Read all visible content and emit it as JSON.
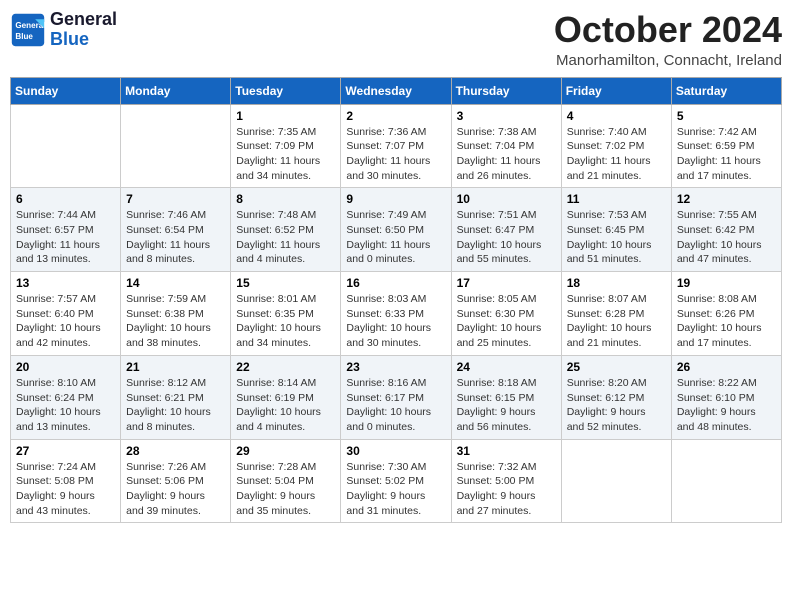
{
  "header": {
    "logo_line1": "General",
    "logo_line2": "Blue",
    "month": "October 2024",
    "location": "Manorhamilton, Connacht, Ireland"
  },
  "days_of_week": [
    "Sunday",
    "Monday",
    "Tuesday",
    "Wednesday",
    "Thursday",
    "Friday",
    "Saturday"
  ],
  "weeks": [
    [
      {
        "day": "",
        "detail": ""
      },
      {
        "day": "",
        "detail": ""
      },
      {
        "day": "1",
        "detail": "Sunrise: 7:35 AM\nSunset: 7:09 PM\nDaylight: 11 hours\nand 34 minutes."
      },
      {
        "day": "2",
        "detail": "Sunrise: 7:36 AM\nSunset: 7:07 PM\nDaylight: 11 hours\nand 30 minutes."
      },
      {
        "day": "3",
        "detail": "Sunrise: 7:38 AM\nSunset: 7:04 PM\nDaylight: 11 hours\nand 26 minutes."
      },
      {
        "day": "4",
        "detail": "Sunrise: 7:40 AM\nSunset: 7:02 PM\nDaylight: 11 hours\nand 21 minutes."
      },
      {
        "day": "5",
        "detail": "Sunrise: 7:42 AM\nSunset: 6:59 PM\nDaylight: 11 hours\nand 17 minutes."
      }
    ],
    [
      {
        "day": "6",
        "detail": "Sunrise: 7:44 AM\nSunset: 6:57 PM\nDaylight: 11 hours\nand 13 minutes."
      },
      {
        "day": "7",
        "detail": "Sunrise: 7:46 AM\nSunset: 6:54 PM\nDaylight: 11 hours\nand 8 minutes."
      },
      {
        "day": "8",
        "detail": "Sunrise: 7:48 AM\nSunset: 6:52 PM\nDaylight: 11 hours\nand 4 minutes."
      },
      {
        "day": "9",
        "detail": "Sunrise: 7:49 AM\nSunset: 6:50 PM\nDaylight: 11 hours\nand 0 minutes."
      },
      {
        "day": "10",
        "detail": "Sunrise: 7:51 AM\nSunset: 6:47 PM\nDaylight: 10 hours\nand 55 minutes."
      },
      {
        "day": "11",
        "detail": "Sunrise: 7:53 AM\nSunset: 6:45 PM\nDaylight: 10 hours\nand 51 minutes."
      },
      {
        "day": "12",
        "detail": "Sunrise: 7:55 AM\nSunset: 6:42 PM\nDaylight: 10 hours\nand 47 minutes."
      }
    ],
    [
      {
        "day": "13",
        "detail": "Sunrise: 7:57 AM\nSunset: 6:40 PM\nDaylight: 10 hours\nand 42 minutes."
      },
      {
        "day": "14",
        "detail": "Sunrise: 7:59 AM\nSunset: 6:38 PM\nDaylight: 10 hours\nand 38 minutes."
      },
      {
        "day": "15",
        "detail": "Sunrise: 8:01 AM\nSunset: 6:35 PM\nDaylight: 10 hours\nand 34 minutes."
      },
      {
        "day": "16",
        "detail": "Sunrise: 8:03 AM\nSunset: 6:33 PM\nDaylight: 10 hours\nand 30 minutes."
      },
      {
        "day": "17",
        "detail": "Sunrise: 8:05 AM\nSunset: 6:30 PM\nDaylight: 10 hours\nand 25 minutes."
      },
      {
        "day": "18",
        "detail": "Sunrise: 8:07 AM\nSunset: 6:28 PM\nDaylight: 10 hours\nand 21 minutes."
      },
      {
        "day": "19",
        "detail": "Sunrise: 8:08 AM\nSunset: 6:26 PM\nDaylight: 10 hours\nand 17 minutes."
      }
    ],
    [
      {
        "day": "20",
        "detail": "Sunrise: 8:10 AM\nSunset: 6:24 PM\nDaylight: 10 hours\nand 13 minutes."
      },
      {
        "day": "21",
        "detail": "Sunrise: 8:12 AM\nSunset: 6:21 PM\nDaylight: 10 hours\nand 8 minutes."
      },
      {
        "day": "22",
        "detail": "Sunrise: 8:14 AM\nSunset: 6:19 PM\nDaylight: 10 hours\nand 4 minutes."
      },
      {
        "day": "23",
        "detail": "Sunrise: 8:16 AM\nSunset: 6:17 PM\nDaylight: 10 hours\nand 0 minutes."
      },
      {
        "day": "24",
        "detail": "Sunrise: 8:18 AM\nSunset: 6:15 PM\nDaylight: 9 hours\nand 56 minutes."
      },
      {
        "day": "25",
        "detail": "Sunrise: 8:20 AM\nSunset: 6:12 PM\nDaylight: 9 hours\nand 52 minutes."
      },
      {
        "day": "26",
        "detail": "Sunrise: 8:22 AM\nSunset: 6:10 PM\nDaylight: 9 hours\nand 48 minutes."
      }
    ],
    [
      {
        "day": "27",
        "detail": "Sunrise: 7:24 AM\nSunset: 5:08 PM\nDaylight: 9 hours\nand 43 minutes."
      },
      {
        "day": "28",
        "detail": "Sunrise: 7:26 AM\nSunset: 5:06 PM\nDaylight: 9 hours\nand 39 minutes."
      },
      {
        "day": "29",
        "detail": "Sunrise: 7:28 AM\nSunset: 5:04 PM\nDaylight: 9 hours\nand 35 minutes."
      },
      {
        "day": "30",
        "detail": "Sunrise: 7:30 AM\nSunset: 5:02 PM\nDaylight: 9 hours\nand 31 minutes."
      },
      {
        "day": "31",
        "detail": "Sunrise: 7:32 AM\nSunset: 5:00 PM\nDaylight: 9 hours\nand 27 minutes."
      },
      {
        "day": "",
        "detail": ""
      },
      {
        "day": "",
        "detail": ""
      }
    ]
  ]
}
